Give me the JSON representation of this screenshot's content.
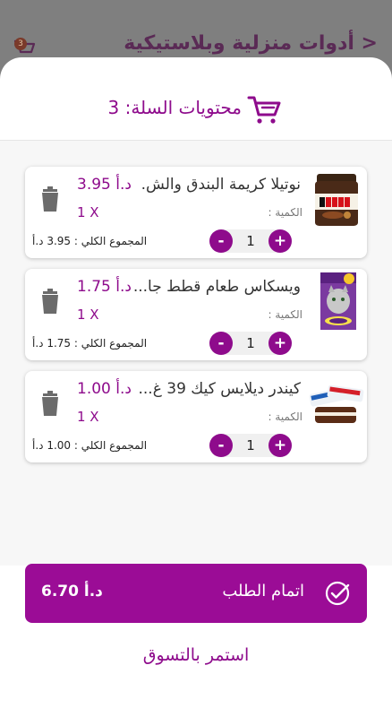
{
  "background": {
    "title": "< أدوات منزلية وبلاستيكية",
    "cart_badge": "3"
  },
  "sheet": {
    "title": "محتويات السلة: 3",
    "cart_icon": "shopping-cart-icon"
  },
  "items": [
    {
      "name": "نوتيلا كريمة البندق والش.",
      "price": "3.95 د.أ",
      "qty_label": "الكمية :",
      "qty_x": "1 X",
      "quantity": "1",
      "total": "المجموع الكلي : 3.95 د.أ",
      "minus": "-",
      "plus": "+"
    },
    {
      "name": "ويسكاس طعام قطط جا...",
      "price": "1.75 د.أ",
      "qty_label": "الكمية :",
      "qty_x": "1 X",
      "quantity": "1",
      "total": "المجموع الكلي : 1.75 د.أ",
      "minus": "-",
      "plus": "+"
    },
    {
      "name": "كيندر ديلايس كيك 39 غ...",
      "price": "1.00 د.أ",
      "qty_label": "الكمية :",
      "qty_x": "1 X",
      "quantity": "1",
      "total": "المجموع الكلي : 1.00 د.أ",
      "minus": "-",
      "plus": "+"
    }
  ],
  "checkout": {
    "label": "اتمام الطلب",
    "total": "6.70 د.أ"
  },
  "continue_label": "استمر بالتسوق",
  "colors": {
    "accent": "#8e0b8c",
    "checkout_bg": "#9b0c96"
  }
}
